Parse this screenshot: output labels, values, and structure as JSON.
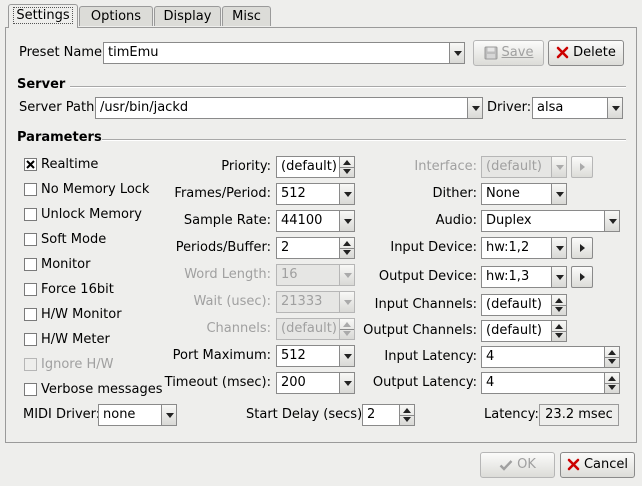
{
  "tabs": [
    {
      "label": "Settings",
      "active": true
    },
    {
      "label": "Options",
      "active": false
    },
    {
      "label": "Display",
      "active": false
    },
    {
      "label": "Misc",
      "active": false
    }
  ],
  "preset": {
    "label": "Preset Name:",
    "value": "timEmu",
    "save_label": "Save",
    "delete_label": "Delete"
  },
  "server": {
    "section_label": "Server",
    "path_label": "Server Path:",
    "path_value": "/usr/bin/jackd",
    "driver_label": "Driver:",
    "driver_value": "alsa"
  },
  "parameters": {
    "section_label": "Parameters",
    "checkboxes": [
      {
        "label": "Realtime",
        "checked": true,
        "enabled": true
      },
      {
        "label": "No Memory Lock",
        "checked": false,
        "enabled": true
      },
      {
        "label": "Unlock Memory",
        "checked": false,
        "enabled": true
      },
      {
        "label": "Soft Mode",
        "checked": false,
        "enabled": true
      },
      {
        "label": "Monitor",
        "checked": false,
        "enabled": true
      },
      {
        "label": "Force 16bit",
        "checked": false,
        "enabled": true
      },
      {
        "label": "H/W Monitor",
        "checked": false,
        "enabled": true
      },
      {
        "label": "H/W Meter",
        "checked": false,
        "enabled": true
      },
      {
        "label": "Ignore H/W",
        "checked": false,
        "enabled": false
      },
      {
        "label": "Verbose messages",
        "checked": false,
        "enabled": true
      }
    ],
    "priority": {
      "label": "Priority:",
      "value": "(default)"
    },
    "frames_period": {
      "label": "Frames/Period:",
      "value": "512"
    },
    "sample_rate": {
      "label": "Sample Rate:",
      "value": "44100"
    },
    "periods_buffer": {
      "label": "Periods/Buffer:",
      "value": "2"
    },
    "word_length": {
      "label": "Word Length:",
      "value": "16"
    },
    "wait": {
      "label": "Wait (usec):",
      "value": "21333"
    },
    "channels": {
      "label": "Channels:",
      "value": "(default)"
    },
    "port_maximum": {
      "label": "Port Maximum:",
      "value": "512"
    },
    "timeout": {
      "label": "Timeout (msec):",
      "value": "200"
    },
    "interface": {
      "label": "Interface:",
      "value": "(default)"
    },
    "dither": {
      "label": "Dither:",
      "value": "None"
    },
    "audio": {
      "label": "Audio:",
      "value": "Duplex"
    },
    "input_device": {
      "label": "Input Device:",
      "value": "hw:1,2"
    },
    "output_device": {
      "label": "Output Device:",
      "value": "hw:1,3"
    },
    "input_channels": {
      "label": "Input Channels:",
      "value": "(default)"
    },
    "output_channels": {
      "label": "Output Channels:",
      "value": "(default)"
    },
    "input_latency": {
      "label": "Input Latency:",
      "value": "4"
    },
    "output_latency": {
      "label": "Output Latency:",
      "value": "4"
    },
    "midi_driver": {
      "label": "MIDI Driver:",
      "value": "none"
    },
    "start_delay": {
      "label": "Start Delay (secs):",
      "value": "2"
    },
    "latency": {
      "label": "Latency:",
      "value": "23.2 msec"
    }
  },
  "footer": {
    "ok_label": "OK",
    "cancel_label": "Cancel"
  },
  "colors": {
    "window_bg": "#eeeeec",
    "delete_icon": "#cc0000",
    "ok_icon_disabled": "#a0a0a0"
  }
}
